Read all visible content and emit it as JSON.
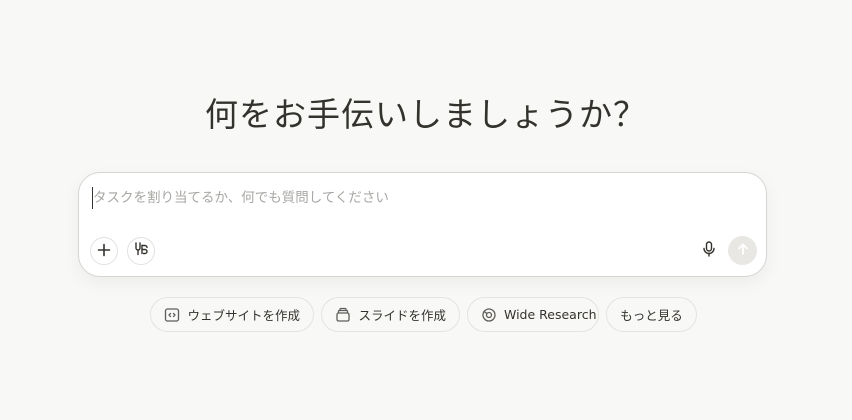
{
  "heading": "何をお手伝いしましょうか？",
  "composer": {
    "placeholder": "タスクを割り当てるか、何でも質問してください"
  },
  "icons": {
    "add": "plus-icon",
    "connect": "connector-icon",
    "mic": "microphone-icon",
    "send": "arrow-up-icon"
  },
  "suggestions": [
    {
      "label": "ウェブサイトを作成",
      "icon": "code-window-icon"
    },
    {
      "label": "スライドを作成",
      "icon": "slides-icon"
    },
    {
      "label": "Wide Research",
      "icon": "globe-icon"
    },
    {
      "label": "もっと見る"
    }
  ],
  "colors": {
    "background": "#f8f8f7",
    "text": "#34322d",
    "placeholder": "#a8a7a3",
    "send_button": "#e8e7e4"
  }
}
